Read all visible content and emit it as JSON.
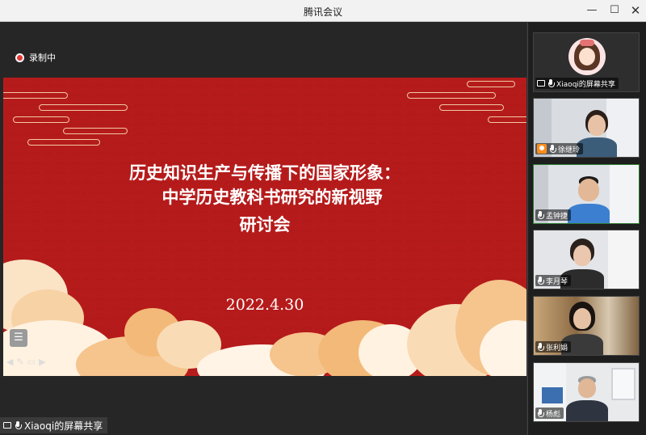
{
  "window": {
    "title": "腾讯会议",
    "controls": {
      "minimize": "—",
      "maximize": "☐",
      "close": "✕"
    }
  },
  "stage": {
    "recording_label": "录制中",
    "share_label": "Xiaoqi的屏幕共享",
    "slide": {
      "title_line1": "历史知识生产与传播下的国家形象：",
      "title_line2": "中学历史教科书研究的新视野",
      "title_line3": "研讨会",
      "date": "2022.4.30"
    },
    "slide_toolbar": [
      "◀",
      "✎",
      "▭",
      "▶"
    ],
    "list_icon": "☰"
  },
  "participants": [
    {
      "name": "Xiaoqi的屏幕共享",
      "type": "avatar",
      "sharing": true
    },
    {
      "name": "徐继玲",
      "type": "video",
      "host": true
    },
    {
      "name": "孟钟捷",
      "type": "video",
      "active": true
    },
    {
      "name": "李月琴",
      "type": "video"
    },
    {
      "name": "张利娟",
      "type": "video"
    },
    {
      "name": "杨彪",
      "type": "video"
    }
  ],
  "colors": {
    "slide_red": "#b61b1b",
    "recording_red": "#e53935",
    "active_border": "#2e7d32",
    "host_badge": "#ff8c1a"
  }
}
